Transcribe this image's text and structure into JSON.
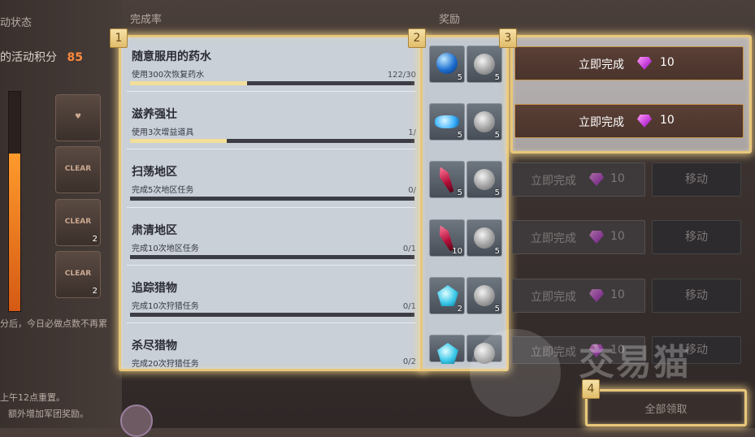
{
  "left_panel": {
    "status_label": "动状态",
    "points_label": "的活动积分",
    "points_value": "85",
    "points_fill_fraction": 0.72,
    "badges": [
      {
        "text": "",
        "count": ""
      },
      {
        "text": "CLEAR",
        "count": ""
      },
      {
        "text": "CLEAR",
        "count": "2"
      },
      {
        "text": "CLEAR",
        "count": "2"
      }
    ],
    "note_line1": "分后，今日必做点数不再累",
    "note_line2": "上午12点重置。",
    "note_line3": "额外增加军团奖励。"
  },
  "headers": {
    "completion": "完成率",
    "reward": "奖励"
  },
  "tags": [
    "1",
    "2",
    "3",
    "4"
  ],
  "tasks": [
    {
      "title": "随意服用的药水",
      "desc": "使用300次恢复药水",
      "count": "122/30",
      "progress": 0.41
    },
    {
      "title": "滋养强壮",
      "desc": "使用3次增益道具",
      "count": "1/",
      "progress": 0.34
    },
    {
      "title": "扫荡地区",
      "desc": "完成5次地区任务",
      "count": "0/",
      "progress": 0
    },
    {
      "title": "肃清地区",
      "desc": "完成10次地区任务",
      "count": "0/1",
      "progress": 0
    },
    {
      "title": "追踪猎物",
      "desc": "完成10次狩猎任务",
      "count": "0/1",
      "progress": 0
    },
    {
      "title": "杀尽猎物",
      "desc": "完成20次狩猎任务",
      "count": "0/2",
      "progress": 0
    }
  ],
  "rewards": [
    {
      "item_icon": "blue-orb-icon",
      "item_qty": "5",
      "coin_qty": "5"
    },
    {
      "item_icon": "blue-crystal-pile-icon",
      "item_qty": "5",
      "coin_qty": "5"
    },
    {
      "item_icon": "red-crystal-icon",
      "item_qty": "5",
      "coin_qty": "5"
    },
    {
      "item_icon": "red-crystal-icon",
      "item_qty": "10",
      "coin_qty": "5"
    },
    {
      "item_icon": "cyan-gem-icon",
      "item_qty": "2",
      "coin_qty": "5"
    },
    {
      "item_icon": "cyan-gem-icon",
      "item_qty": "",
      "coin_qty": ""
    }
  ],
  "actions": {
    "complete_now": "立即完成",
    "cost": "10",
    "move": "移动",
    "claim_all": "全部领取"
  },
  "watermark": "交易猫"
}
